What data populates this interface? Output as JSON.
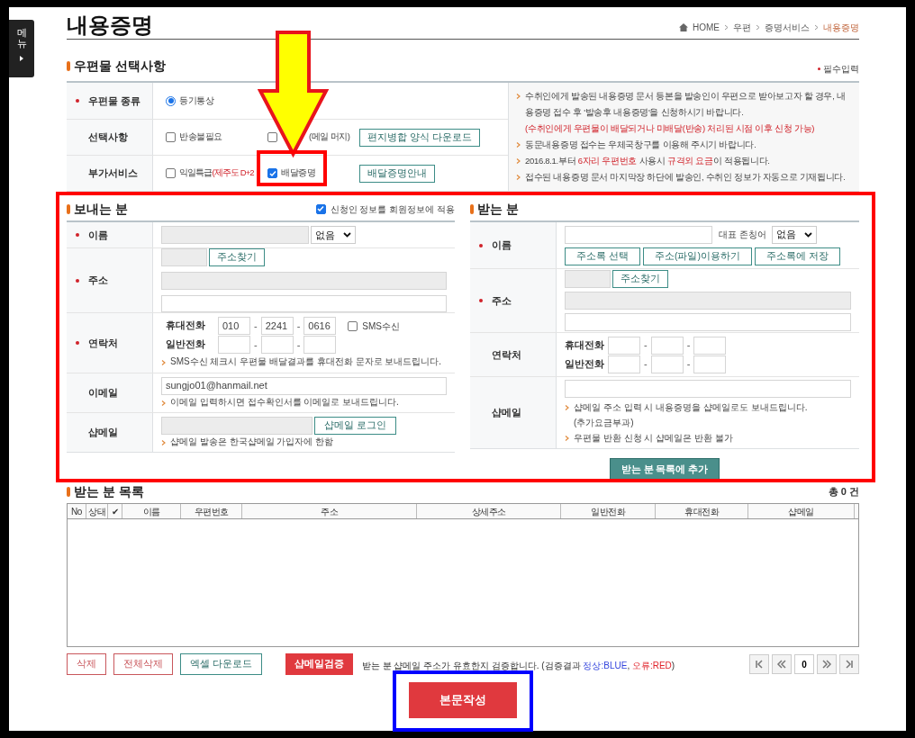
{
  "side_menu": {
    "label": "메뉴"
  },
  "page_title": "내용증명",
  "breadcrumb": [
    {
      "label": "HOME",
      "selected": false
    },
    {
      "label": "우편",
      "selected": false
    },
    {
      "label": "증명서비스",
      "selected": false
    },
    {
      "label": "내용증명",
      "selected": true
    }
  ],
  "mail_options": {
    "title": "우편물 선택사항",
    "required_note": "필수입력",
    "rows": [
      {
        "label": "우편물 종류",
        "required": true,
        "items": [
          {
            "kind": "radio",
            "parts": [
              {
                "text": "등기통상",
                "red": false
              }
            ],
            "checked": true
          }
        ]
      },
      {
        "label": "선택사항",
        "required": false,
        "items": [
          {
            "kind": "checkbox",
            "parts": [
              {
                "text": "반송불필요",
                "red": false
              }
            ],
            "checked": false
          },
          {
            "kind": "checkbox",
            "parts": [
              {
                "text": "(메일 머지)",
                "red": false
              }
            ],
            "checked": false
          },
          {
            "kind": "button",
            "parts": [
              {
                "text": "편지병합 양식 다운로드",
                "red": false
              }
            ]
          }
        ]
      },
      {
        "label": "부가서비스",
        "required": false,
        "items": [
          {
            "kind": "checkbox",
            "parts": [
              {
                "text": "익일특급",
                "red": false
              },
              {
                "text": "(제주도 D+2",
                "red": true
              }
            ],
            "checked": false
          },
          {
            "kind": "checkbox",
            "parts": [
              {
                "text": "배달증명",
                "red": false
              }
            ],
            "checked": true
          },
          {
            "kind": "button",
            "parts": [
              {
                "text": "배달증명안내",
                "red": false
              }
            ]
          }
        ]
      }
    ],
    "notes": [
      {
        "bullet": true,
        "parts": [
          {
            "text": "수취인에게 발송된 내용증명 문서 등본을 발송인이 우편으로 받아보고자 할 경우, 내용증명 접수 후 '발송후 내용증명'을 신청하시기 바랍니다.",
            "red": false
          }
        ]
      },
      {
        "bullet": false,
        "parts": [
          {
            "text": "(수취인에게 우편물이 배달되거나 미배달(반송) 처리된 시점 이후 신청 가능)",
            "red": true
          }
        ]
      },
      {
        "bullet": true,
        "parts": [
          {
            "text": "동문내용증명 접수는 우체국창구를 이용해 주시기 바랍니다.",
            "red": false
          }
        ]
      },
      {
        "bullet": true,
        "parts": [
          {
            "text": "2016.8.1.부터 ",
            "red": false
          },
          {
            "text": "6자리 우편번호",
            "red": true
          },
          {
            "text": " 사용시 ",
            "red": false
          },
          {
            "text": "규격외 요금",
            "red": true
          },
          {
            "text": "이 적용됩니다.",
            "red": false
          }
        ]
      },
      {
        "bullet": true,
        "parts": [
          {
            "text": "접수된 내용증명 문서 마지막장 하단에 발송인, 수취인 정보가 자동으로 기재됩니다.",
            "red": false
          }
        ]
      }
    ]
  },
  "sender": {
    "title": "보내는 분",
    "apply_member": {
      "label": "신청인 정보를 회원정보에 적용",
      "checked": true
    },
    "name": {
      "label": "이름",
      "required": true,
      "honorific": "없음"
    },
    "address": {
      "label": "주소",
      "required": true,
      "search_button": "주소찾기"
    },
    "contact": {
      "label": "연락처",
      "required": true,
      "mobile_label": "휴대전화",
      "mobile": [
        "010",
        "2241",
        "0616"
      ],
      "separators": [
        "-",
        "-",
        "-",
        "-"
      ],
      "sms": {
        "label": "SMS수신",
        "checked": false
      },
      "phone_label": "일반전화",
      "note": "SMS수신 체크시 우편물 배달결과를 휴대전화 문자로 보내드립니다."
    },
    "email": {
      "label": "이메일",
      "required": false,
      "value": "sungjo01@hanmail.net",
      "note": "이메일 입력하시면 접수확인서를 이메일로 보내드립니다."
    },
    "shopmail": {
      "label": "샵메일",
      "required": false,
      "button": "샵메일 로그인",
      "note": "샵메일 발송은 한국샵메일 가입자에 한함"
    }
  },
  "receiver": {
    "title": "받는 분",
    "name": {
      "label": "이름",
      "required": true,
      "honorific_label": "대표 존칭어",
      "honorific": "없음",
      "buttons": [
        "주소록 선택",
        "주소(파일)이용하기",
        "주소록에 저장"
      ]
    },
    "address": {
      "label": "주소",
      "required": true,
      "search_button": "주소찾기"
    },
    "contact": {
      "label": "연락처",
      "required": false,
      "mobile_label": "휴대전화",
      "phone_label": "일반전화",
      "separators": [
        "-",
        "-",
        "-",
        "-"
      ]
    },
    "shopmail": {
      "label": "샵메일",
      "required": false,
      "notes": [
        {
          "bullet": true,
          "text": "샵메일 주소 입력 시 내용증명을 샵메일로도 보내드립니다."
        },
        {
          "bullet": false,
          "text": "(추가요금부과)"
        },
        {
          "bullet": true,
          "text": "우편물 반환 신청 시 샵메일은 반환 불가"
        }
      ]
    },
    "add_button": "받는 분 목록에 추가"
  },
  "recipient_list": {
    "title": "받는 분 목록",
    "total": "총 0 건",
    "columns": [
      "No",
      "상태",
      "✔",
      "이름",
      "우편번호",
      "주소",
      "상세주소",
      "일반전화",
      "휴대전화",
      "샵메일"
    ]
  },
  "list_actions": [
    {
      "kind": "red-outline",
      "label": "삭제"
    },
    {
      "kind": "red-outline",
      "label": "전체삭제"
    },
    {
      "kind": "green-outline",
      "label": "엑셀 다운로드"
    },
    {
      "kind": "red-solid",
      "label": "샵메일검증"
    }
  ],
  "verify_note": [
    {
      "text": "받는 분 샵메일 주소가 유효한지 검증합니다. (검증결과 ",
      "kind": "plain"
    },
    {
      "text": "정상:BLUE",
      "kind": "blue"
    },
    {
      "text": ", ",
      "kind": "plain"
    },
    {
      "text": "오류:RED",
      "kind": "red"
    },
    {
      "text": ")",
      "kind": "plain"
    }
  ],
  "pager": {
    "page": "0"
  },
  "submit_button": "본문작성",
  "annotations": [
    {
      "kind": "arrow",
      "color": "#ffff00"
    },
    {
      "kind": "frame",
      "color": "#ff0000"
    },
    {
      "kind": "frame",
      "color": "#ff0000"
    },
    {
      "kind": "frame",
      "color": "#0000ff"
    }
  ]
}
